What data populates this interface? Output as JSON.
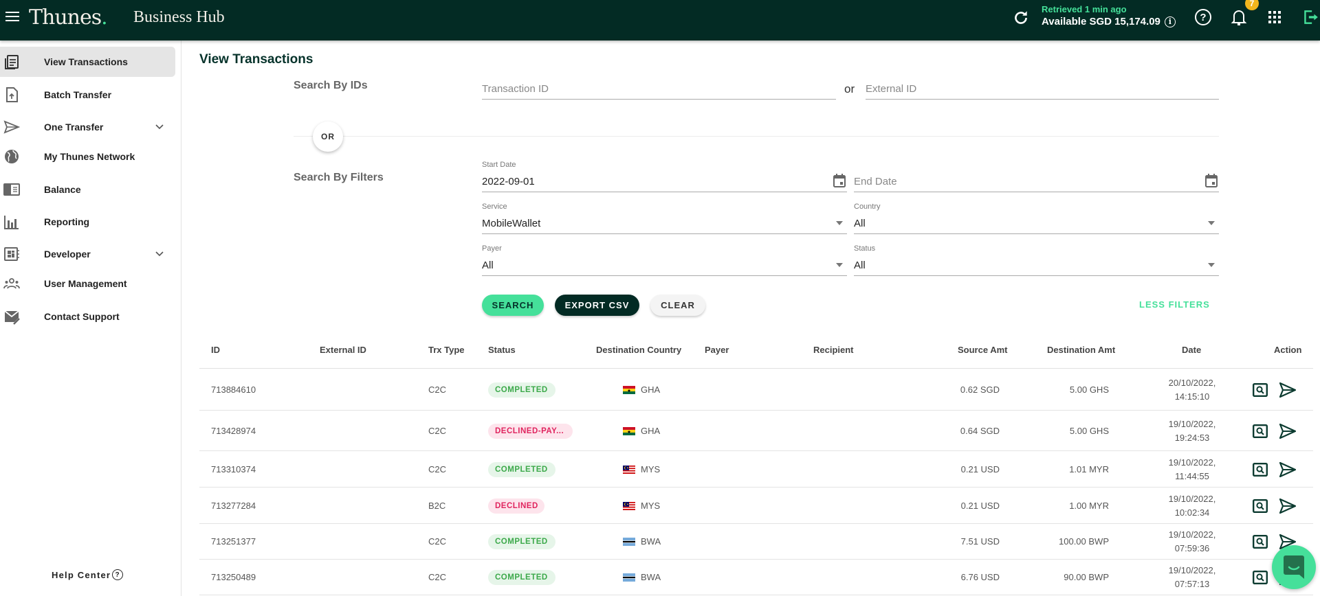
{
  "topbar": {
    "brand": "Thunes",
    "brand_dot": ".",
    "app_title": "Business Hub",
    "retrieved": "Retrieved 1 min ago",
    "available": "Available SGD 15,174.09",
    "notifications_count": "7",
    "colors": {
      "bg": "#032b24",
      "accent": "#45e09a",
      "badge": "#f2b51d"
    }
  },
  "sidebar": {
    "items": [
      {
        "label": "View Transactions",
        "icon": "clipboard-list-icon",
        "active": true
      },
      {
        "label": "Batch Transfer",
        "icon": "file-upload-icon"
      },
      {
        "label": "One Transfer",
        "icon": "send-icon",
        "expandable": true
      },
      {
        "label": "My Thunes Network",
        "icon": "globe-icon"
      },
      {
        "label": "Balance",
        "icon": "balance-icon"
      },
      {
        "label": "Reporting",
        "icon": "bar-chart-icon"
      },
      {
        "label": "Developer",
        "icon": "developer-board-icon",
        "expandable": true
      },
      {
        "label": "User Management",
        "icon": "users-icon"
      },
      {
        "label": "Contact Support",
        "icon": "mail-edit-icon"
      }
    ],
    "help_center": "Help Center",
    "help_glyph": "?"
  },
  "page": {
    "title": "View Transactions",
    "search_by_ids": "Search By IDs",
    "transaction_id_placeholder": "Transaction ID",
    "or_inline": "or",
    "external_id_placeholder": "External ID",
    "or_divider": "OR",
    "search_by_filters": "Search By Filters",
    "filters": {
      "start_date": {
        "label": "Start Date",
        "value": "2022-09-01"
      },
      "end_date": {
        "placeholder": "End Date"
      },
      "service": {
        "label": "Service",
        "value": "MobileWallet"
      },
      "country": {
        "label": "Country",
        "value": "All"
      },
      "payer": {
        "label": "Payer",
        "value": "All"
      },
      "status": {
        "label": "Status",
        "value": "All"
      }
    },
    "buttons": {
      "search": "SEARCH",
      "export": "EXPORT CSV",
      "clear": "CLEAR",
      "less_filters": "LESS FILTERS"
    }
  },
  "table": {
    "columns": [
      "ID",
      "External ID",
      "Trx Type",
      "Status",
      "Destination Country",
      "Payer",
      "Recipient",
      "Source Amt",
      "Destination Amt",
      "Date",
      "Action"
    ],
    "rows": [
      {
        "id": "713884610",
        "external_id": "",
        "trx_type": "C2C",
        "status": "COMPLETED",
        "status_kind": "ok",
        "country": "GHA",
        "flag": "ghana",
        "payer": "",
        "recipient": "",
        "source_amt": "0.62 SGD",
        "dest_amt": "5.00 GHS",
        "date": "20/10/2022,",
        "time": "14:15:10"
      },
      {
        "id": "713428974",
        "external_id": "",
        "trx_type": "C2C",
        "status": "DECLINED-PAY...",
        "status_kind": "bad",
        "country": "GHA",
        "flag": "ghana",
        "payer": "",
        "recipient": "",
        "source_amt": "0.64 SGD",
        "dest_amt": "5.00 GHS",
        "date": "19/10/2022,",
        "time": "19:24:53"
      },
      {
        "id": "713310374",
        "external_id": "",
        "trx_type": "C2C",
        "status": "COMPLETED",
        "status_kind": "ok",
        "country": "MYS",
        "flag": "malaysia",
        "payer": "",
        "recipient": "",
        "source_amt": "0.21 USD",
        "dest_amt": "1.01 MYR",
        "date": "19/10/2022,",
        "time": "11:44:55"
      },
      {
        "id": "713277284",
        "external_id": "",
        "trx_type": "B2C",
        "status": "DECLINED",
        "status_kind": "bad",
        "country": "MYS",
        "flag": "malaysia",
        "payer": "",
        "recipient": "",
        "source_amt": "0.21 USD",
        "dest_amt": "1.00 MYR",
        "date": "19/10/2022,",
        "time": "10:02:34"
      },
      {
        "id": "713251377",
        "external_id": "",
        "trx_type": "C2C",
        "status": "COMPLETED",
        "status_kind": "ok",
        "country": "BWA",
        "flag": "botswana",
        "payer": "",
        "recipient": "",
        "source_amt": "7.51 USD",
        "dest_amt": "100.00 BWP",
        "date": "19/10/2022,",
        "time": "07:59:36"
      },
      {
        "id": "713250489",
        "external_id": "",
        "trx_type": "C2C",
        "status": "COMPLETED",
        "status_kind": "ok",
        "country": "BWA",
        "flag": "botswana",
        "payer": "",
        "recipient": "",
        "source_amt": "6.76 USD",
        "dest_amt": "90.00 BWP",
        "date": "19/10/2022,",
        "time": "07:57:13"
      }
    ]
  }
}
